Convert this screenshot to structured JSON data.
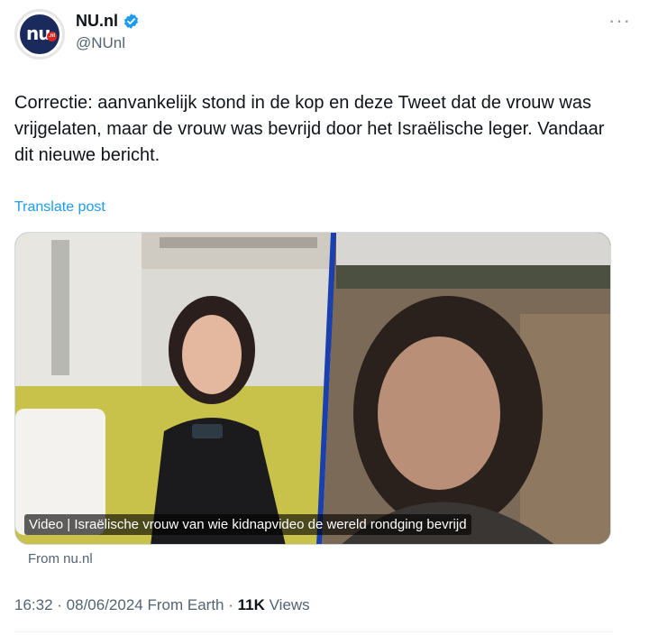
{
  "author": {
    "avatar_text": "nu",
    "avatar_badge": ".nl",
    "display_name": "NU.nl",
    "handle": "@NUnl",
    "verified_icon": "verified-badge-icon",
    "more_icon": "more-options-icon"
  },
  "post": {
    "text": "Correctie: aanvankelijk stond in de kop en deze Tweet dat de vrouw was vrijgelaten, maar de vrouw was bevrijd door het Israëlische leger. Vandaar dit nieuwe bericht.",
    "translate_label": "Translate post"
  },
  "media": {
    "caption": "Video | Israëlische vrouw van wie kidnapvideo de wereld rondging bevrijd",
    "source": "From nu.nl"
  },
  "meta": {
    "time": "16:32",
    "date": "08/06/2024",
    "location": "From Earth",
    "views_count": "11K",
    "views_label": "Views"
  },
  "colors": {
    "link": "#1d9bf0",
    "verified": "#1d9bf0",
    "avatar_bg": "#1b2a5c",
    "secondary_text": "#536471"
  }
}
